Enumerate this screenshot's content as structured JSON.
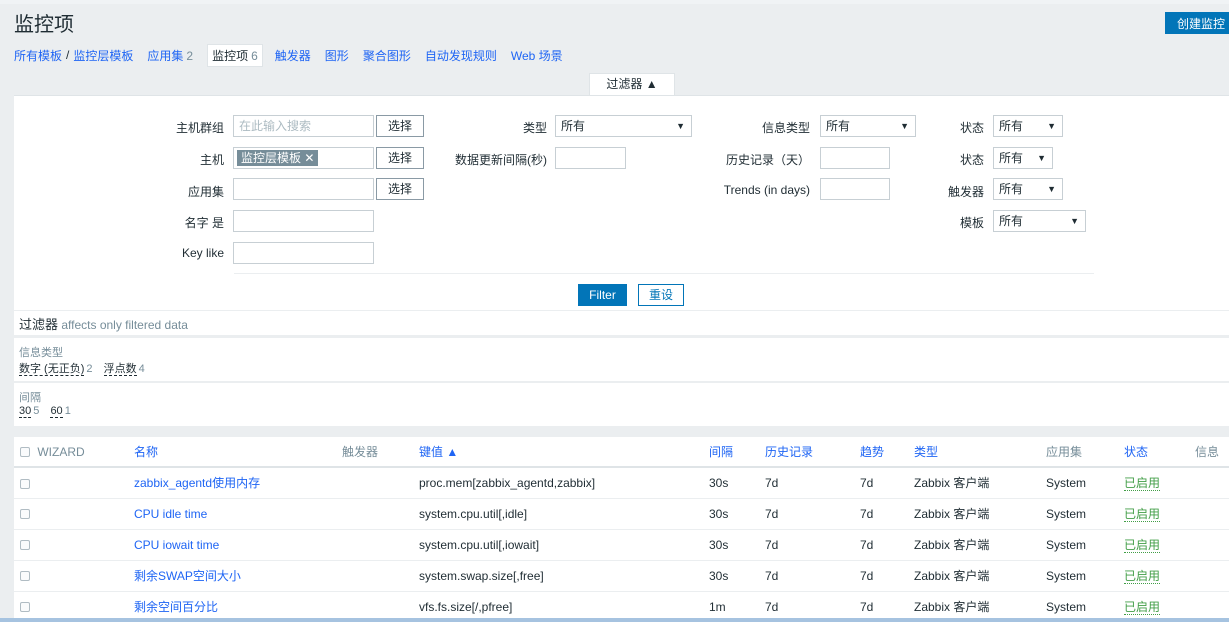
{
  "header": {
    "title": "监控项",
    "create_label": "创建监控"
  },
  "nav": {
    "all_templates": "所有模板",
    "separator": "/",
    "template": "监控层模板",
    "applications": "应用集",
    "applications_count": "2",
    "items": "监控项",
    "items_count": "6",
    "triggers": "触发器",
    "graphs": "图形",
    "screens": "聚合图形",
    "discovery": "自动发现规则",
    "web": "Web 场景"
  },
  "filter": {
    "tab_label": "过滤器 ▲",
    "host_group_label": "主机群组",
    "host_group_placeholder": "在此输入搜索",
    "select_label": "选择",
    "host_label": "主机",
    "host_tag": "监控层模板",
    "application_label": "应用集",
    "name_label": "名字 是",
    "key_label": "Key like",
    "type_label": "类型",
    "type_value": "所有",
    "interval_label": "数据更新间隔(秒)",
    "info_type_label": "信息类型",
    "info_type_value": "所有",
    "history_label": "历史记录（天）",
    "trends_label": "Trends (in days)",
    "state_label": "状态",
    "state_value": "所有",
    "status_label": "状态",
    "status_value": "所有",
    "triggers_label": "触发器",
    "triggers_value": "所有",
    "template_label": "模板",
    "template_value": "所有",
    "filter_button": "Filter",
    "reset_button": "重设"
  },
  "subfilter": {
    "title": "过滤器",
    "hint": "affects only filtered data",
    "groups": [
      {
        "name": "信息类型",
        "items": [
          {
            "label": "数字 (无正负)",
            "count": "2"
          },
          {
            "label": "浮点数",
            "count": "4"
          }
        ]
      },
      {
        "name": "间隔",
        "items": [
          {
            "label": "30",
            "count": "5"
          },
          {
            "label": "60",
            "count": "1"
          }
        ]
      }
    ]
  },
  "table": {
    "headers": {
      "wizard": "WIZARD",
      "name": "名称",
      "triggers": "触发器",
      "key": "键值 ▲",
      "interval": "间隔",
      "history": "历史记录",
      "trends": "趋势",
      "type": "类型",
      "applications": "应用集",
      "status": "状态",
      "info": "信息"
    },
    "rows": [
      {
        "name": "zabbix_agentd使用内存",
        "key": "proc.mem[zabbix_agentd,zabbix]",
        "interval": "30s",
        "history": "7d",
        "trends": "7d",
        "type": "Zabbix 客户端",
        "app": "System",
        "status": "已启用"
      },
      {
        "name": "CPU idle time",
        "key": "system.cpu.util[,idle]",
        "interval": "30s",
        "history": "7d",
        "trends": "7d",
        "type": "Zabbix 客户端",
        "app": "System",
        "status": "已启用"
      },
      {
        "name": "CPU iowait time",
        "key": "system.cpu.util[,iowait]",
        "interval": "30s",
        "history": "7d",
        "trends": "7d",
        "type": "Zabbix 客户端",
        "app": "System",
        "status": "已启用"
      },
      {
        "name": "剩余SWAP空间大小",
        "key": "system.swap.size[,free]",
        "interval": "30s",
        "history": "7d",
        "trends": "7d",
        "type": "Zabbix 客户端",
        "app": "System",
        "status": "已启用"
      },
      {
        "name": "剩余空间百分比",
        "key": "vfs.fs.size[/,pfree]",
        "interval": "1m",
        "history": "7d",
        "trends": "7d",
        "type": "Zabbix 客户端",
        "app": "System",
        "status": "已启用"
      }
    ]
  }
}
